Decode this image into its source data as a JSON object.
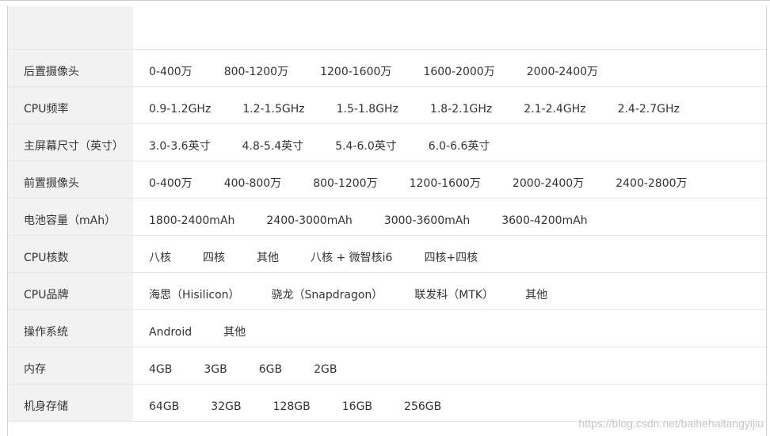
{
  "rows": [
    {
      "label": "后置摄像头",
      "options": [
        "0-400万",
        "800-1200万",
        "1200-1600万",
        "1600-2000万",
        "2000-2400万"
      ]
    },
    {
      "label": "CPU频率",
      "options": [
        "0.9-1.2GHz",
        "1.2-1.5GHz",
        "1.5-1.8GHz",
        "1.8-2.1GHz",
        "2.1-2.4GHz",
        "2.4-2.7GHz"
      ]
    },
    {
      "label": "主屏幕尺寸（英寸）",
      "options": [
        "3.0-3.6英寸",
        "4.8-5.4英寸",
        "5.4-6.0英寸",
        "6.0-6.6英寸"
      ]
    },
    {
      "label": "前置摄像头",
      "options": [
        "0-400万",
        "400-800万",
        "800-1200万",
        "1200-1600万",
        "2000-2400万",
        "2400-2800万"
      ]
    },
    {
      "label": "电池容量（mAh）",
      "options": [
        "1800-2400mAh",
        "2400-3000mAh",
        "3000-3600mAh",
        "3600-4200mAh"
      ]
    },
    {
      "label": "CPU核数",
      "options": [
        "八核",
        "四核",
        "其他",
        "八核 + 微智核i6",
        "四核+四核"
      ]
    },
    {
      "label": "CPU品牌",
      "options": [
        "海思（Hisilicon）",
        "骁龙（Snapdragon）",
        "联发科（MTK）",
        "其他"
      ]
    },
    {
      "label": "操作系统",
      "options": [
        "Android",
        "其他"
      ]
    },
    {
      "label": "内存",
      "options": [
        "4GB",
        "3GB",
        "6GB",
        "2GB"
      ]
    },
    {
      "label": "机身存储",
      "options": [
        "64GB",
        "32GB",
        "128GB",
        "16GB",
        "256GB"
      ]
    }
  ],
  "watermark": "https://blog.csdn.net/baihehaitangyijiu"
}
